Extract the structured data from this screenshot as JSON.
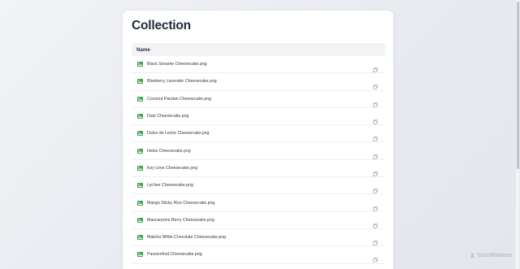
{
  "page": {
    "title": "Collection"
  },
  "table": {
    "header": "Name",
    "rows": [
      {
        "name": "Black Sesame Cheesecake.png"
      },
      {
        "name": "Blueberry Lavender Cheesecake.png"
      },
      {
        "name": "Coconut Pandan Cheesecake.png"
      },
      {
        "name": "Date Cheesecake.png"
      },
      {
        "name": "Dulce de Leche Cheesecake.png"
      },
      {
        "name": "Halva Cheesecake.png"
      },
      {
        "name": "Key Lime Cheesecake.png"
      },
      {
        "name": "Lychee Cheesecake.png"
      },
      {
        "name": "Mango Sticky Rice Cheesecake.png"
      },
      {
        "name": "Mascarpone Berry Cheesecake.png"
      },
      {
        "name": "Matcha White Chocolate Cheesecake.png"
      },
      {
        "name": "Passionfruit Cheesecake.png"
      }
    ]
  },
  "icons": {
    "file": "image-file-icon",
    "action": "copy-icon"
  },
  "watermark": {
    "text": "ScanMalware"
  },
  "colors": {
    "icon_green": "#3fa34d",
    "title_text": "#1e2a3a",
    "header_bg": "#f1f3f5"
  }
}
